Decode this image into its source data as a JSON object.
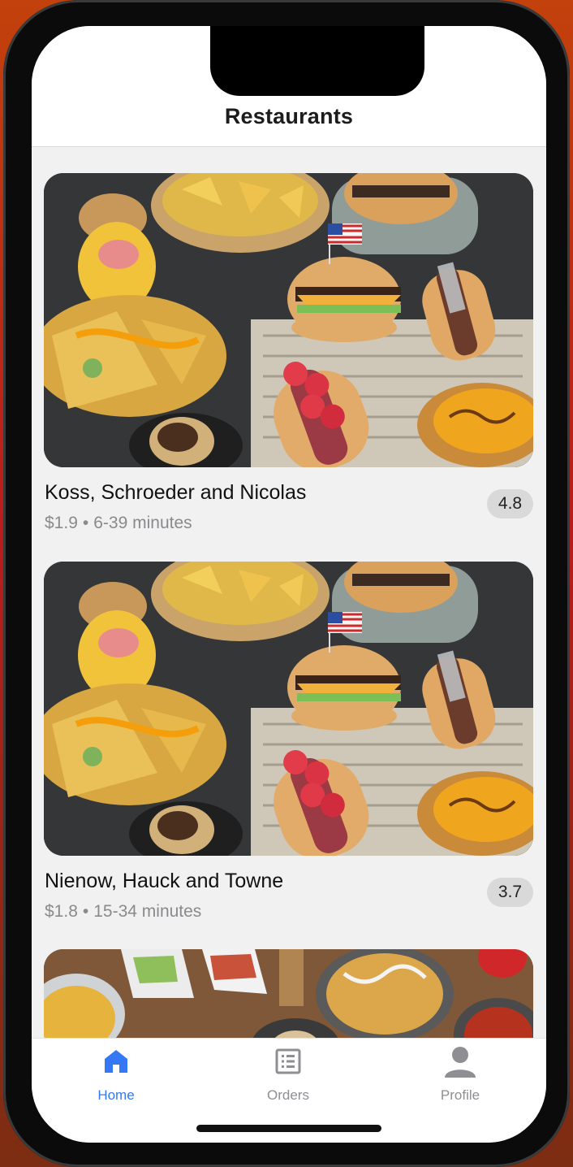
{
  "header": {
    "title": "Restaurants"
  },
  "restaurants": [
    {
      "name": "Koss, Schroeder and Nicolas",
      "price": "$1.9",
      "separator": "•",
      "time": "6-39 minutes",
      "rating": "4.8"
    },
    {
      "name": "Nienow, Hauck and Towne",
      "price": "$1.8",
      "separator": "•",
      "time": "15-34 minutes",
      "rating": "3.7"
    },
    {
      "name": "",
      "price": "",
      "separator": "",
      "time": "",
      "rating": ""
    }
  ],
  "tabbar": {
    "items": [
      {
        "label": "Home",
        "icon": "home-icon",
        "active": true
      },
      {
        "label": "Orders",
        "icon": "list-icon",
        "active": false
      },
      {
        "label": "Profile",
        "icon": "person-icon",
        "active": false
      }
    ],
    "active_color": "#3478f6",
    "inactive_color": "#8e8e93"
  }
}
